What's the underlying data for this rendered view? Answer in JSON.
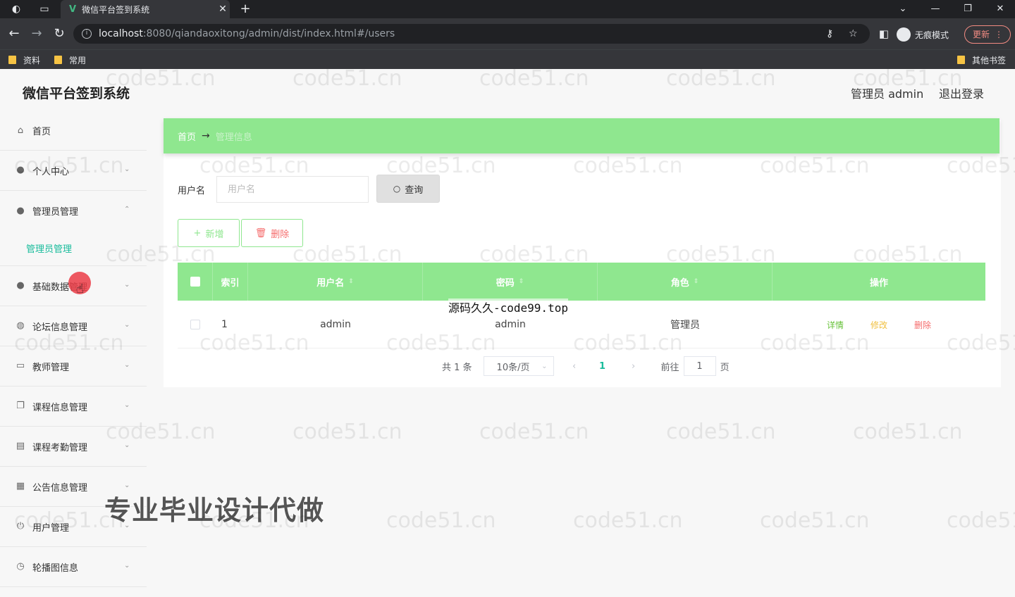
{
  "browser": {
    "tab_title": "微信平台签到系统",
    "tab_close": "✕",
    "new_tab": "+",
    "url_host": "localhost",
    "url_path": ":8080/qiandaoxitong/admin/dist/index.html#/users",
    "incognito_label": "无痕模式",
    "update_label": "更新",
    "bookmarks": [
      "资料",
      "常用"
    ],
    "other_bookmarks": "其他书签"
  },
  "app": {
    "title": "微信平台签到系统",
    "user_label": "管理员 admin",
    "logout_label": "退出登录"
  },
  "sidebar": {
    "items": [
      {
        "label": "首页",
        "icon": "home-icon",
        "glyph": "⌂"
      },
      {
        "label": "个人中心",
        "icon": "user-icon",
        "glyph": "●",
        "chevron": "⌄"
      },
      {
        "label": "管理员管理",
        "icon": "user-icon",
        "glyph": "●",
        "chevron": "⌃"
      },
      {
        "label": "基础数据管理",
        "icon": "bulb-icon",
        "glyph": "●",
        "chevron": "⌄"
      },
      {
        "label": "论坛信息管理",
        "icon": "mic-icon",
        "glyph": "◍",
        "chevron": "⌄"
      },
      {
        "label": "教师管理",
        "icon": "chat-icon",
        "glyph": "▭",
        "chevron": "⌄"
      },
      {
        "label": "课程信息管理",
        "icon": "copy-icon",
        "glyph": "❐",
        "chevron": "⌄"
      },
      {
        "label": "课程考勤管理",
        "icon": "doc-icon",
        "glyph": "▤",
        "chevron": "⌄"
      },
      {
        "label": "公告信息管理",
        "icon": "grid-icon",
        "glyph": "▦",
        "chevron": "⌄"
      },
      {
        "label": "用户管理",
        "icon": "power-icon",
        "glyph": "⏻",
        "chevron": "⌄"
      },
      {
        "label": "轮播图信息",
        "icon": "clock-icon",
        "glyph": "◷",
        "chevron": "⌄"
      }
    ],
    "submenu_active": "管理员管理"
  },
  "breadcrumb": {
    "home": "首页",
    "arrow": "→",
    "current": "管理信息"
  },
  "search": {
    "label": "用户名",
    "placeholder": "用户名",
    "button_label": "查询"
  },
  "actions": {
    "add_label": "新增",
    "delete_label": "删除"
  },
  "table": {
    "columns": [
      "索引",
      "用户名",
      "密码",
      "角色",
      "操作"
    ],
    "rows": [
      {
        "index": "1",
        "username": "admin",
        "password": "admin",
        "role": "管理员",
        "ops": [
          "详情",
          "修改",
          "删除"
        ]
      }
    ]
  },
  "pagination": {
    "total": "共 1 条",
    "page_size": "10条/页",
    "current_page": "1",
    "goto_label": "前往",
    "goto_value": "1",
    "page_unit": "页"
  },
  "overlays": {
    "site_text": "源码久久-code99.top",
    "promo_text": "专业毕业设计代做",
    "watermark": "code51.cn"
  },
  "colors": {
    "accent_green": "#8fe78f",
    "active_teal": "#1abc9c",
    "danger": "#f56c6c"
  }
}
